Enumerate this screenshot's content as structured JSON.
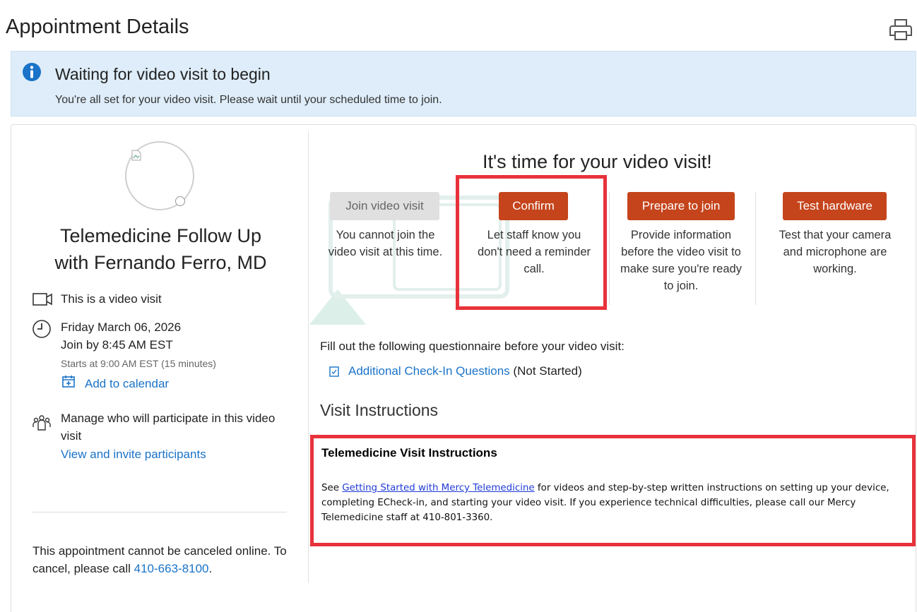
{
  "page": {
    "title": "Appointment Details"
  },
  "banner": {
    "title": "Waiting for video visit to begin",
    "text": "You're all set for your video visit. Please wait until your scheduled time to join."
  },
  "left": {
    "visit_title_line1": "Telemedicine Follow Up",
    "visit_title_line2": "with Fernando Ferro, MD",
    "video_visit_label": "This is a video visit",
    "date": "Friday March 06, 2026",
    "join_by": "Join by 8:45 AM EST",
    "starts_at": "Starts at 9:00 AM EST (15 minutes)",
    "add_to_calendar": "Add to calendar",
    "manage_line1": "Manage who will participate in this video",
    "manage_line2": "visit",
    "invite_link": "View and invite participants",
    "cancel_text": "This appointment cannot be canceled online. To cancel, please call ",
    "cancel_phone": "410-663-8100",
    "cancel_end": "."
  },
  "video": {
    "heading": "It's time for your video visit!",
    "actions": [
      {
        "label": "Join video visit",
        "desc": "You cannot join the video visit at this time.",
        "enabled": false
      },
      {
        "label": "Confirm",
        "desc": "Let staff know you don't need a reminder call.",
        "enabled": true
      },
      {
        "label": "Prepare to join",
        "desc": "Provide information before the video visit to make sure you're ready to join.",
        "enabled": true
      },
      {
        "label": "Test hardware",
        "desc": "Test that your camera and microphone are working.",
        "enabled": true
      }
    ]
  },
  "questionnaire": {
    "intro": "Fill out the following questionnaire before your video visit:",
    "link": "Additional Check-In Questions",
    "status": "(Not Started)"
  },
  "instructions": {
    "heading": "Visit Instructions",
    "title": "Telemedicine Visit Instructions",
    "body_prefix": "See ",
    "body_link": "Getting Started with Mercy Telemedicine",
    "body_suffix": " for videos and step-by-step written instructions on setting up your device, completing ECheck-in, and starting your video visit. If you experience technical difficulties, please call our Mercy Telemedicine staff at 410-801-3360."
  },
  "colors": {
    "accent_button": "#c5441c",
    "link": "#1a73c8",
    "banner_bg": "#deedf9",
    "highlight": "#e8323b"
  },
  "icons": [
    "printer-icon",
    "info-icon",
    "video-camera-icon",
    "clock-icon",
    "calendar-add-icon",
    "participants-icon",
    "checklist-icon"
  ]
}
